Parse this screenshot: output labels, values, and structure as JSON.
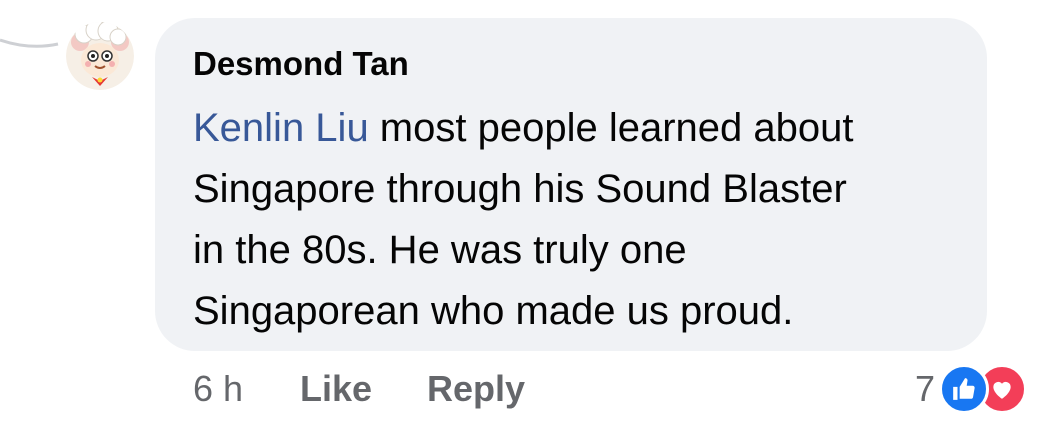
{
  "comment": {
    "author": "Desmond Tan",
    "mention": "Kenlin Liu",
    "text_lines": [
      " most people learned about",
      "Singapore through his Sound Blaster",
      "in the 80s. He was truly one",
      "Singaporean who made us proud."
    ],
    "time": "6 h",
    "like_label": "Like",
    "reply_label": "Reply",
    "reaction_count": "7",
    "reactions": [
      "like-icon",
      "love-icon"
    ]
  },
  "colors": {
    "bubble_bg": "#f0f2f5",
    "mention": "#385898",
    "meta_text": "#65676b",
    "like_blue": "#1877f2",
    "love_red": "#f33e58"
  }
}
